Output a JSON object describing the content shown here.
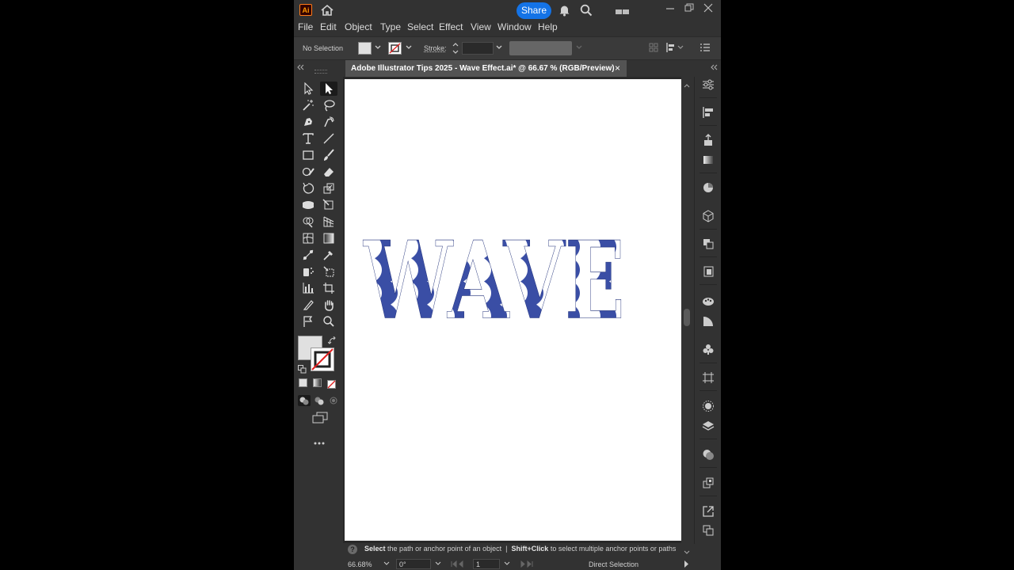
{
  "app": {
    "logo_text": "Ai",
    "share_label": "Share"
  },
  "menu": [
    "File",
    "Edit",
    "Object",
    "Type",
    "Select",
    "Effect",
    "View",
    "Window",
    "Help"
  ],
  "control_bar": {
    "selection_label": "No Selection",
    "stroke_label": "Stroke:"
  },
  "document": {
    "tab_title": "Adobe Illustrator Tips 2025 - Wave Effect.ai* @ 66.67 % (RGB/Preview)",
    "close_glyph": "×",
    "artwork_text": "WAVE"
  },
  "status": {
    "help_icon_glyph": "?",
    "hint_bold_1": "Select",
    "hint_1": "the path or anchor point of an object",
    "separator": "|",
    "hint_bold_2": "Shift+Click",
    "hint_2": "to select multiple anchor points or paths"
  },
  "bottom": {
    "zoom": "66.68%",
    "rotation": "0°",
    "artboard_number": "1",
    "current_tool": "Direct Selection"
  },
  "colors": {
    "wave_fill": "#3a4ea5",
    "accent": "#1473e6",
    "ui_bg": "#323232"
  }
}
